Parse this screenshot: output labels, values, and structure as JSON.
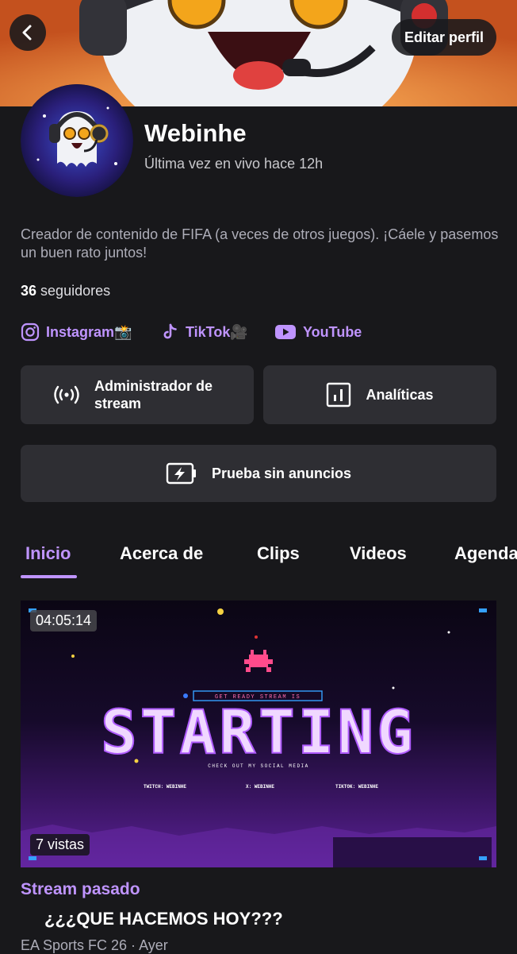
{
  "header": {
    "edit_label": "Editar perfil"
  },
  "profile": {
    "name": "Webinhe",
    "last_live": "Última vez en vivo hace 12h",
    "bio": "Creador de contenido de FIFA (a veces de otros juegos). ¡Cáele y pasemos un buen rato juntos!",
    "followers_count": "36",
    "followers_label": "seguidores"
  },
  "socials": [
    {
      "label": "Instagram📸",
      "icon": "instagram-icon"
    },
    {
      "label": "TikTok🎥",
      "icon": "tiktok-icon"
    },
    {
      "label": "YouTube",
      "icon": "youtube-icon"
    }
  ],
  "actions": {
    "stream_manager": "Administrador de stream",
    "analytics": "Analíticas",
    "ad_free_trial": "Prueba sin anuncios"
  },
  "tabs": [
    {
      "label": "Inicio",
      "active": true
    },
    {
      "label": "Acerca de",
      "active": false
    },
    {
      "label": "Clips",
      "active": false
    },
    {
      "label": "Videos",
      "active": false
    },
    {
      "label": "Agenda",
      "active": false
    }
  ],
  "video": {
    "duration": "04:05:14",
    "views": "7 vistas",
    "section_label": "Stream pasado",
    "title": "¿¿¿QUE HACEMOS HOY???",
    "meta": "EA Sports FC 26 · Ayer",
    "thumbnail": {
      "banner_text": "GET READY STREAM IS",
      "big_text": "STARTING",
      "sub_text": "CHECK OUT MY SOCIAL MEDIA",
      "handles": [
        "TWITCH: WEBINHE",
        "X: WEBINHE",
        "TIKTOK: WEBINHE"
      ]
    }
  },
  "colors": {
    "accent": "#bf94ff",
    "background": "#18181b",
    "button": "#2e2e33"
  }
}
